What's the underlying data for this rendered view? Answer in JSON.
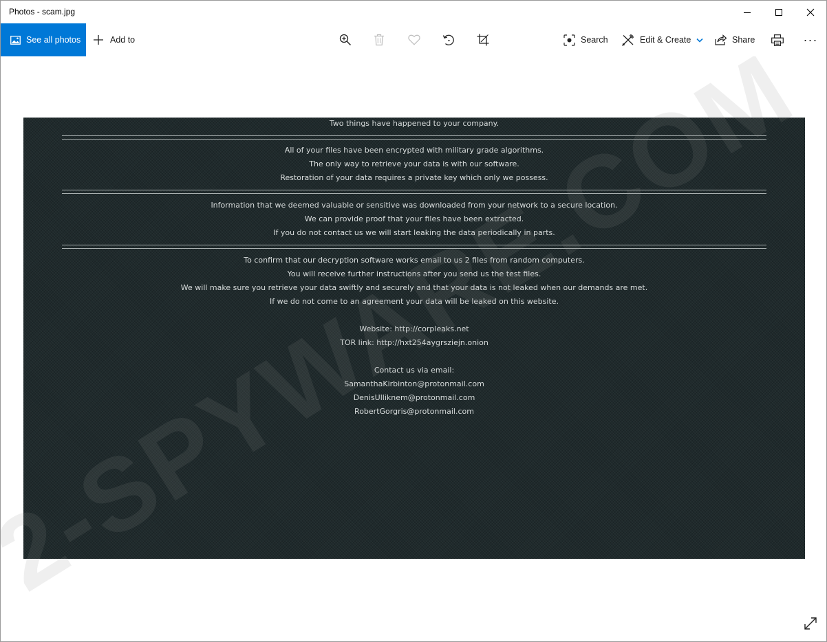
{
  "window": {
    "title": "Photos - scam.jpg"
  },
  "toolbar": {
    "see_all_label": "See all photos",
    "add_to_label": "Add to",
    "search_label": "Search",
    "edit_label": "Edit & Create",
    "share_label": "Share",
    "more_label": "···"
  },
  "ransom_note": {
    "intro": "Two things have happened to your company.",
    "block1": [
      "All of your files have been encrypted with military grade algorithms.",
      "The only way to retrieve your data is with our software.",
      "Restoration of your data requires a private key which only we possess."
    ],
    "block2": [
      "Information that we deemed valuable or sensitive was downloaded from your network to a secure location.",
      "We can provide proof that your files have been extracted.",
      "If you do not contact us we will start leaking the data periodically in parts."
    ],
    "block3": [
      "To confirm that our decryption software works email to us 2 files from random computers.",
      "You will receive further instructions after you send us the test files.",
      "We will make sure you retrieve your data swiftly and securely and that your data is not leaked when our demands are met.",
      "If we do not come to an agreement your data will be leaked on this website."
    ],
    "website": "Website: http://corpleaks.net",
    "tor_link": "TOR link: http://hxt254aygrsziejn.onion",
    "contact_heading": "Contact us via email:",
    "emails": [
      "SamanthaKirbinton@protonmail.com",
      "DenisUlliknem@protonmail.com",
      "RobertGorgris@protonmail.com"
    ]
  },
  "watermark": {
    "text": "2-SPYWARE.COM"
  },
  "colors": {
    "accent": "#0078d7",
    "note_background": "#1f2a2c",
    "note_text": "#d8dcdc"
  }
}
